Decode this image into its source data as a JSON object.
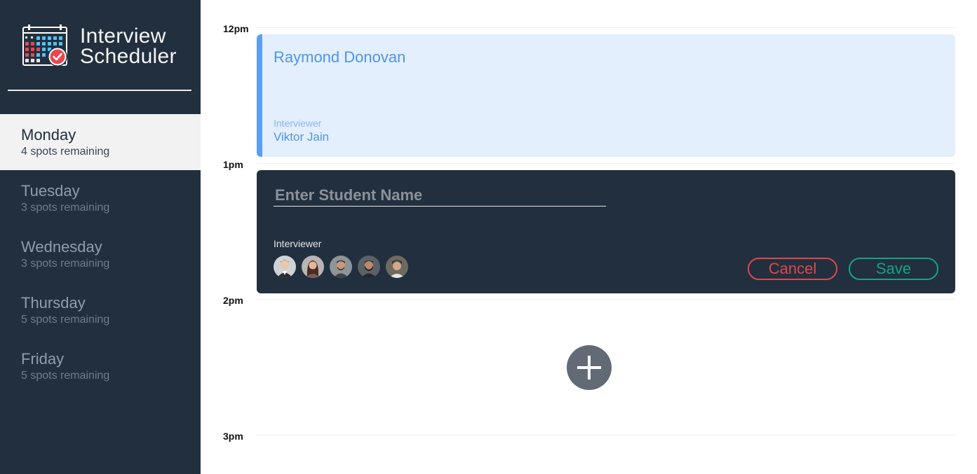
{
  "brand": {
    "line1": "Interview",
    "line2": "Scheduler"
  },
  "days": [
    {
      "name": "Monday",
      "spots": "4 spots remaining",
      "selected": true
    },
    {
      "name": "Tuesday",
      "spots": "3 spots remaining",
      "selected": false
    },
    {
      "name": "Wednesday",
      "spots": "3 spots remaining",
      "selected": false
    },
    {
      "name": "Thursday",
      "spots": "5 spots remaining",
      "selected": false
    },
    {
      "name": "Friday",
      "spots": "5 spots remaining",
      "selected": false
    }
  ],
  "times": [
    "12pm",
    "1pm",
    "2pm",
    "3pm"
  ],
  "appointment": {
    "student": "Raymond Donovan",
    "interviewer_label": "Interviewer",
    "interviewer_name": "Viktor Jain"
  },
  "form": {
    "placeholder": "Enter Student Name",
    "interviewer_label": "Interviewer",
    "cancel_label": "Cancel",
    "save_label": "Save"
  },
  "icons": {
    "logo": "calendar-check-icon",
    "add": "plus-icon"
  },
  "colors": {
    "sidebar_bg": "#222f3e",
    "appointment_accent": "#5b9ef5",
    "appointment_bg": "#e3effd",
    "cancel": "#e0484b",
    "save": "#18a185",
    "add_button": "#626b75"
  }
}
